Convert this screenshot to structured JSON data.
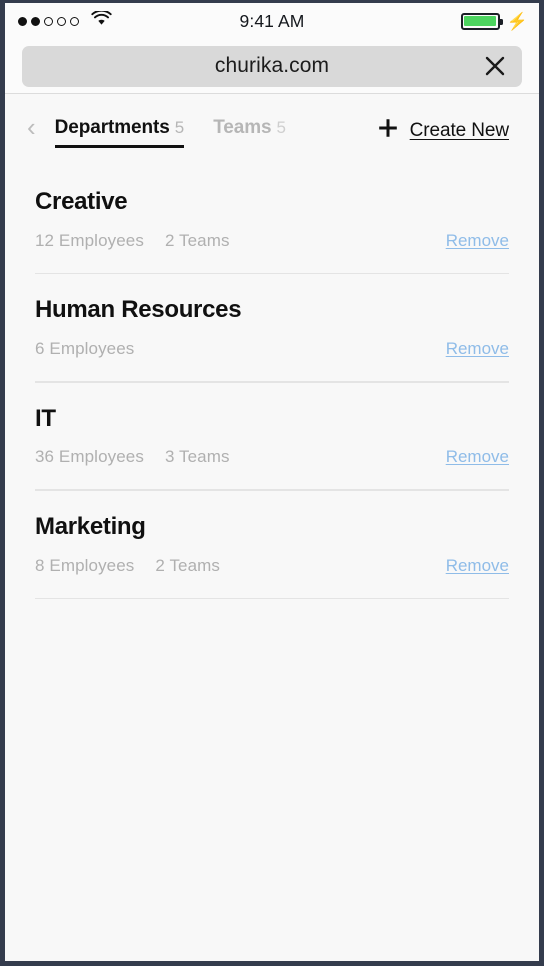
{
  "statusbar": {
    "signal_filled": 2,
    "signal_total": 5,
    "wifi_icon": "wifi-icon",
    "time": "9:41 AM",
    "battery_icon": "battery-full-icon",
    "charging_icon": "lightning-bolt-icon",
    "battery_color": "#4cd45f"
  },
  "browser": {
    "url": "churika.com",
    "close_icon": "close-icon"
  },
  "nav": {
    "back_icon": "chevron-left-icon",
    "tabs": [
      {
        "label": "Departments",
        "count": "5",
        "active": true
      },
      {
        "label": "Teams",
        "count": "5",
        "active": false
      }
    ],
    "create": {
      "icon": "plus-icon",
      "label": "Create New"
    }
  },
  "departments": [
    {
      "name": "Creative",
      "employees": "12 Employees",
      "teams": "2 Teams",
      "remove_label": "Remove"
    },
    {
      "name": "Human Resources",
      "employees": "6 Employees",
      "teams": "",
      "remove_label": "Remove"
    },
    {
      "name": "IT",
      "employees": "36 Employees",
      "teams": "3 Teams",
      "remove_label": "Remove"
    },
    {
      "name": "Marketing",
      "employees": "8 Employees",
      "teams": "2 Teams",
      "remove_label": "Remove"
    }
  ],
  "colors": {
    "link": "#8fbce8",
    "muted": "#b0b0b0",
    "text": "#101010",
    "frame": "#343c4d"
  }
}
